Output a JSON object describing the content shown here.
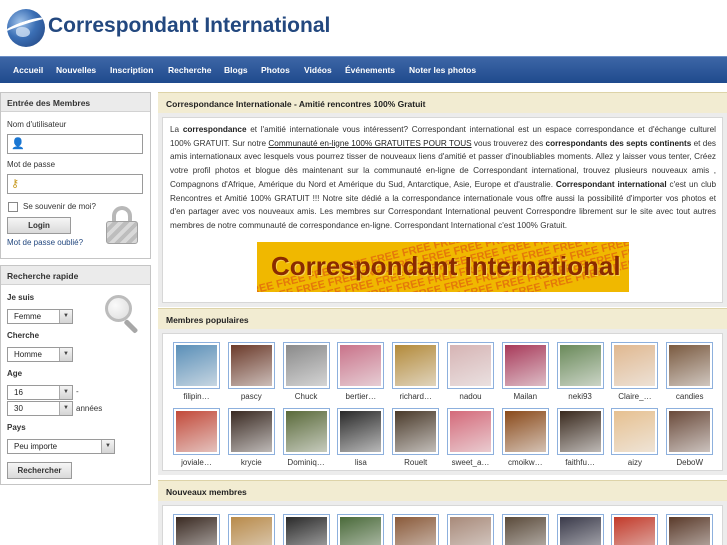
{
  "header": {
    "title": "Correspondant International"
  },
  "nav": [
    "Accueil",
    "Nouvelles",
    "Inscription",
    "Recherche",
    "Blogs",
    "Photos",
    "Vidéos",
    "Événements",
    "Noter les photos"
  ],
  "login": {
    "title": "Entrée des Membres",
    "username_label": "Nom d'utilisateur",
    "password_label": "Mot de passe",
    "remember_label": "Se souvenir de moi?",
    "login_button": "Login",
    "forgot_link": "Mot de passe oublié?"
  },
  "quick_search": {
    "title": "Recherche rapide",
    "iam_label": "Je suis",
    "iam_value": "Femme",
    "seeking_label": "Cherche",
    "seeking_value": "Homme",
    "age_label": "Age",
    "age_from": "16",
    "age_dash": "-",
    "age_to": "30",
    "age_unit": "années",
    "country_label": "Pays",
    "country_value": "Peu importe",
    "search_button": "Rechercher"
  },
  "intro": {
    "title": "Correspondance Internationale - Amitié rencontres 100% Gratuit",
    "p1a": "La ",
    "p1b": "correspondance",
    "p1c": " et l'amitié internationale vous intéressent? Correspondant international est un espace correspondance et d'échange culturel 100% GRATUIT. Sur notre ",
    "p1d": "Communauté en-ligne 100% GRATUITES POUR TOUS",
    "p1e": " vous trouverez des ",
    "p1f": "correspondants des septs continents",
    "p1g": " et des amis internationaux avec lesquels vous pourrez tisser de nouveaux liens d'amitié et passer d'inoubliables moments. Allez y laisser vous tenter, Créez votre profil photos et blogue dès maintenant sur la communauté en-ligne de Correspondant international, trouvez plusieurs nouveaux amis , Compagnons d'Afrique, Amérique du Nord et Amérique du Sud, Antarctique, Asie, Europe et d'australie. ",
    "p1h": "Correspondant international",
    "p1i": " c'est un club Rencontres et Amitié 100% GRATUIT !!! Notre site dédié a la correspondance internationale vous offre aussi la possibilité d'importer vos photos et d'en partager avec vos nouveaux amis. Les membres sur Correspondant International peuvent Correspondre librement sur le site avec tout autres membres de notre communauté de correspondance en-ligne. Correspondant International c'est 100% Gratuit.",
    "banner_text": "Correspondant International",
    "banner_bg": "FREE FREE FREE FREE FREE FREE FREE FREE FREE FREE FREE FREE"
  },
  "popular": {
    "title": "Membres populaires",
    "members": [
      {
        "name": "filipin…",
        "color": "#5a8fb8"
      },
      {
        "name": "pascy",
        "color": "#6b3a2a"
      },
      {
        "name": "Chuck",
        "color": "#8a8a8a"
      },
      {
        "name": "bertier…",
        "color": "#c9738a"
      },
      {
        "name": "richard…",
        "color": "#b38a3a"
      },
      {
        "name": "nadou",
        "color": "#d6b4b4"
      },
      {
        "name": "Mailan",
        "color": "#a83a5a"
      },
      {
        "name": "neki93",
        "color": "#6a8a5a"
      },
      {
        "name": "Claire_…",
        "color": "#e0b890"
      },
      {
        "name": "candies",
        "color": "#7a5a40"
      },
      {
        "name": "joviale…",
        "color": "#c24a3a"
      },
      {
        "name": "krycie",
        "color": "#3a2a22"
      },
      {
        "name": "Dominiq…",
        "color": "#5a6a3a"
      },
      {
        "name": "lisa",
        "color": "#2a2a2a"
      },
      {
        "name": "Rouelt",
        "color": "#4a3a2a"
      },
      {
        "name": "sweet_a…",
        "color": "#d46a7a"
      },
      {
        "name": "cmoikw…",
        "color": "#8a4a1a"
      },
      {
        "name": "faithfu…",
        "color": "#3a2a1e"
      },
      {
        "name": "aizy",
        "color": "#e6c090"
      },
      {
        "name": "DeboW",
        "color": "#6a4a3a"
      }
    ]
  },
  "new_members": {
    "title": "Nouveaux membres",
    "members": [
      {
        "color": "#3a2a22"
      },
      {
        "color": "#b88a4a"
      },
      {
        "color": "#2a2a2a"
      },
      {
        "color": "#4a6a3a"
      },
      {
        "color": "#8a5a3a"
      },
      {
        "color": "#a88a7a"
      },
      {
        "color": "#5a4a3a"
      },
      {
        "color": "#3a3a4a"
      },
      {
        "color": "#c23a2a"
      },
      {
        "color": "#5a3a2a"
      }
    ]
  }
}
